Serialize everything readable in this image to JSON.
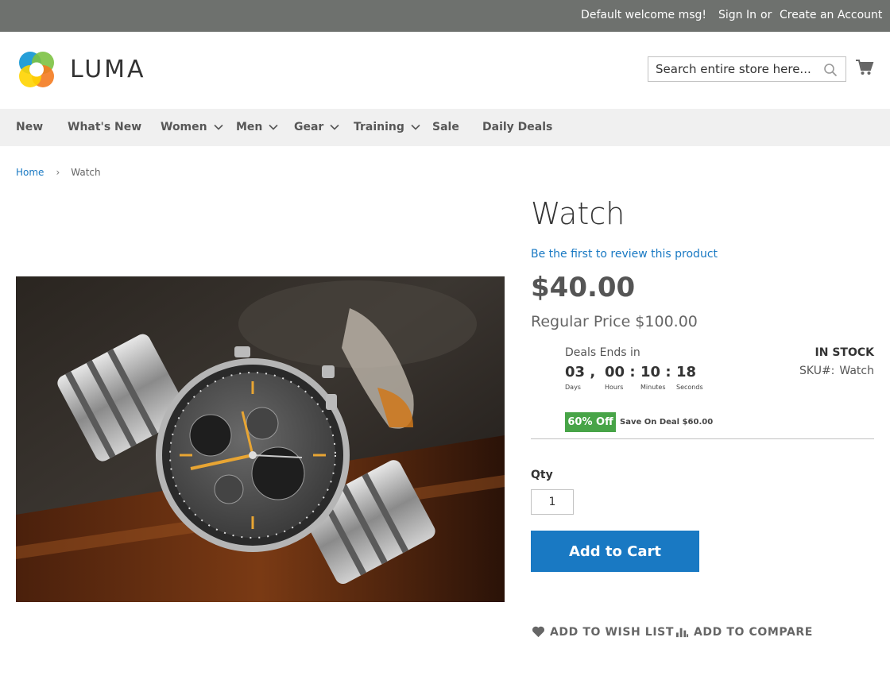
{
  "topbar": {
    "welcome": "Default welcome msg!",
    "sign_in": "Sign In",
    "or": "or",
    "create_account": "Create an Account"
  },
  "header": {
    "logo_text": "LUMA",
    "search_placeholder": "Search entire store here...",
    "cart_icon": "cart-icon"
  },
  "nav": {
    "items": [
      {
        "label": "New",
        "has_dropdown": false
      },
      {
        "label": "What's New",
        "has_dropdown": false
      },
      {
        "label": "Women",
        "has_dropdown": true
      },
      {
        "label": "Men",
        "has_dropdown": true
      },
      {
        "label": "Gear",
        "has_dropdown": true
      },
      {
        "label": "Training",
        "has_dropdown": true
      },
      {
        "label": "Sale",
        "has_dropdown": false
      },
      {
        "label": "Daily Deals",
        "has_dropdown": false
      }
    ]
  },
  "breadcrumb": {
    "home": "Home",
    "separator": "›",
    "current": "Watch"
  },
  "product": {
    "name": "Watch",
    "review_link": "Be the first to review this product",
    "price": "$40.00",
    "regular_price": "Regular Price $100.00",
    "stock": "IN STOCK",
    "sku_label": "SKU#:",
    "sku": "Watch"
  },
  "deal": {
    "label": "Deals Ends in",
    "days": "03",
    "hours": "00",
    "minutes": "10",
    "seconds": "18",
    "sep_days": ",",
    "sep_time": ":",
    "days_label": "Days",
    "hours_label": "Hours",
    "minutes_label": "Minutes",
    "seconds_label": "Seconds",
    "off_badge": "60% Off",
    "save_text": "Save On Deal $60.00"
  },
  "cart_form": {
    "qty_label": "Qty",
    "qty_value": "1",
    "add_to_cart": "Add to Cart"
  },
  "actions": {
    "wishlist": "ADD TO WISH LIST",
    "compare": "ADD TO COMPARE"
  },
  "colors": {
    "topbar": "#6e716e",
    "link": "#1979c3",
    "button": "#1979c3",
    "badge": "#47a447"
  }
}
